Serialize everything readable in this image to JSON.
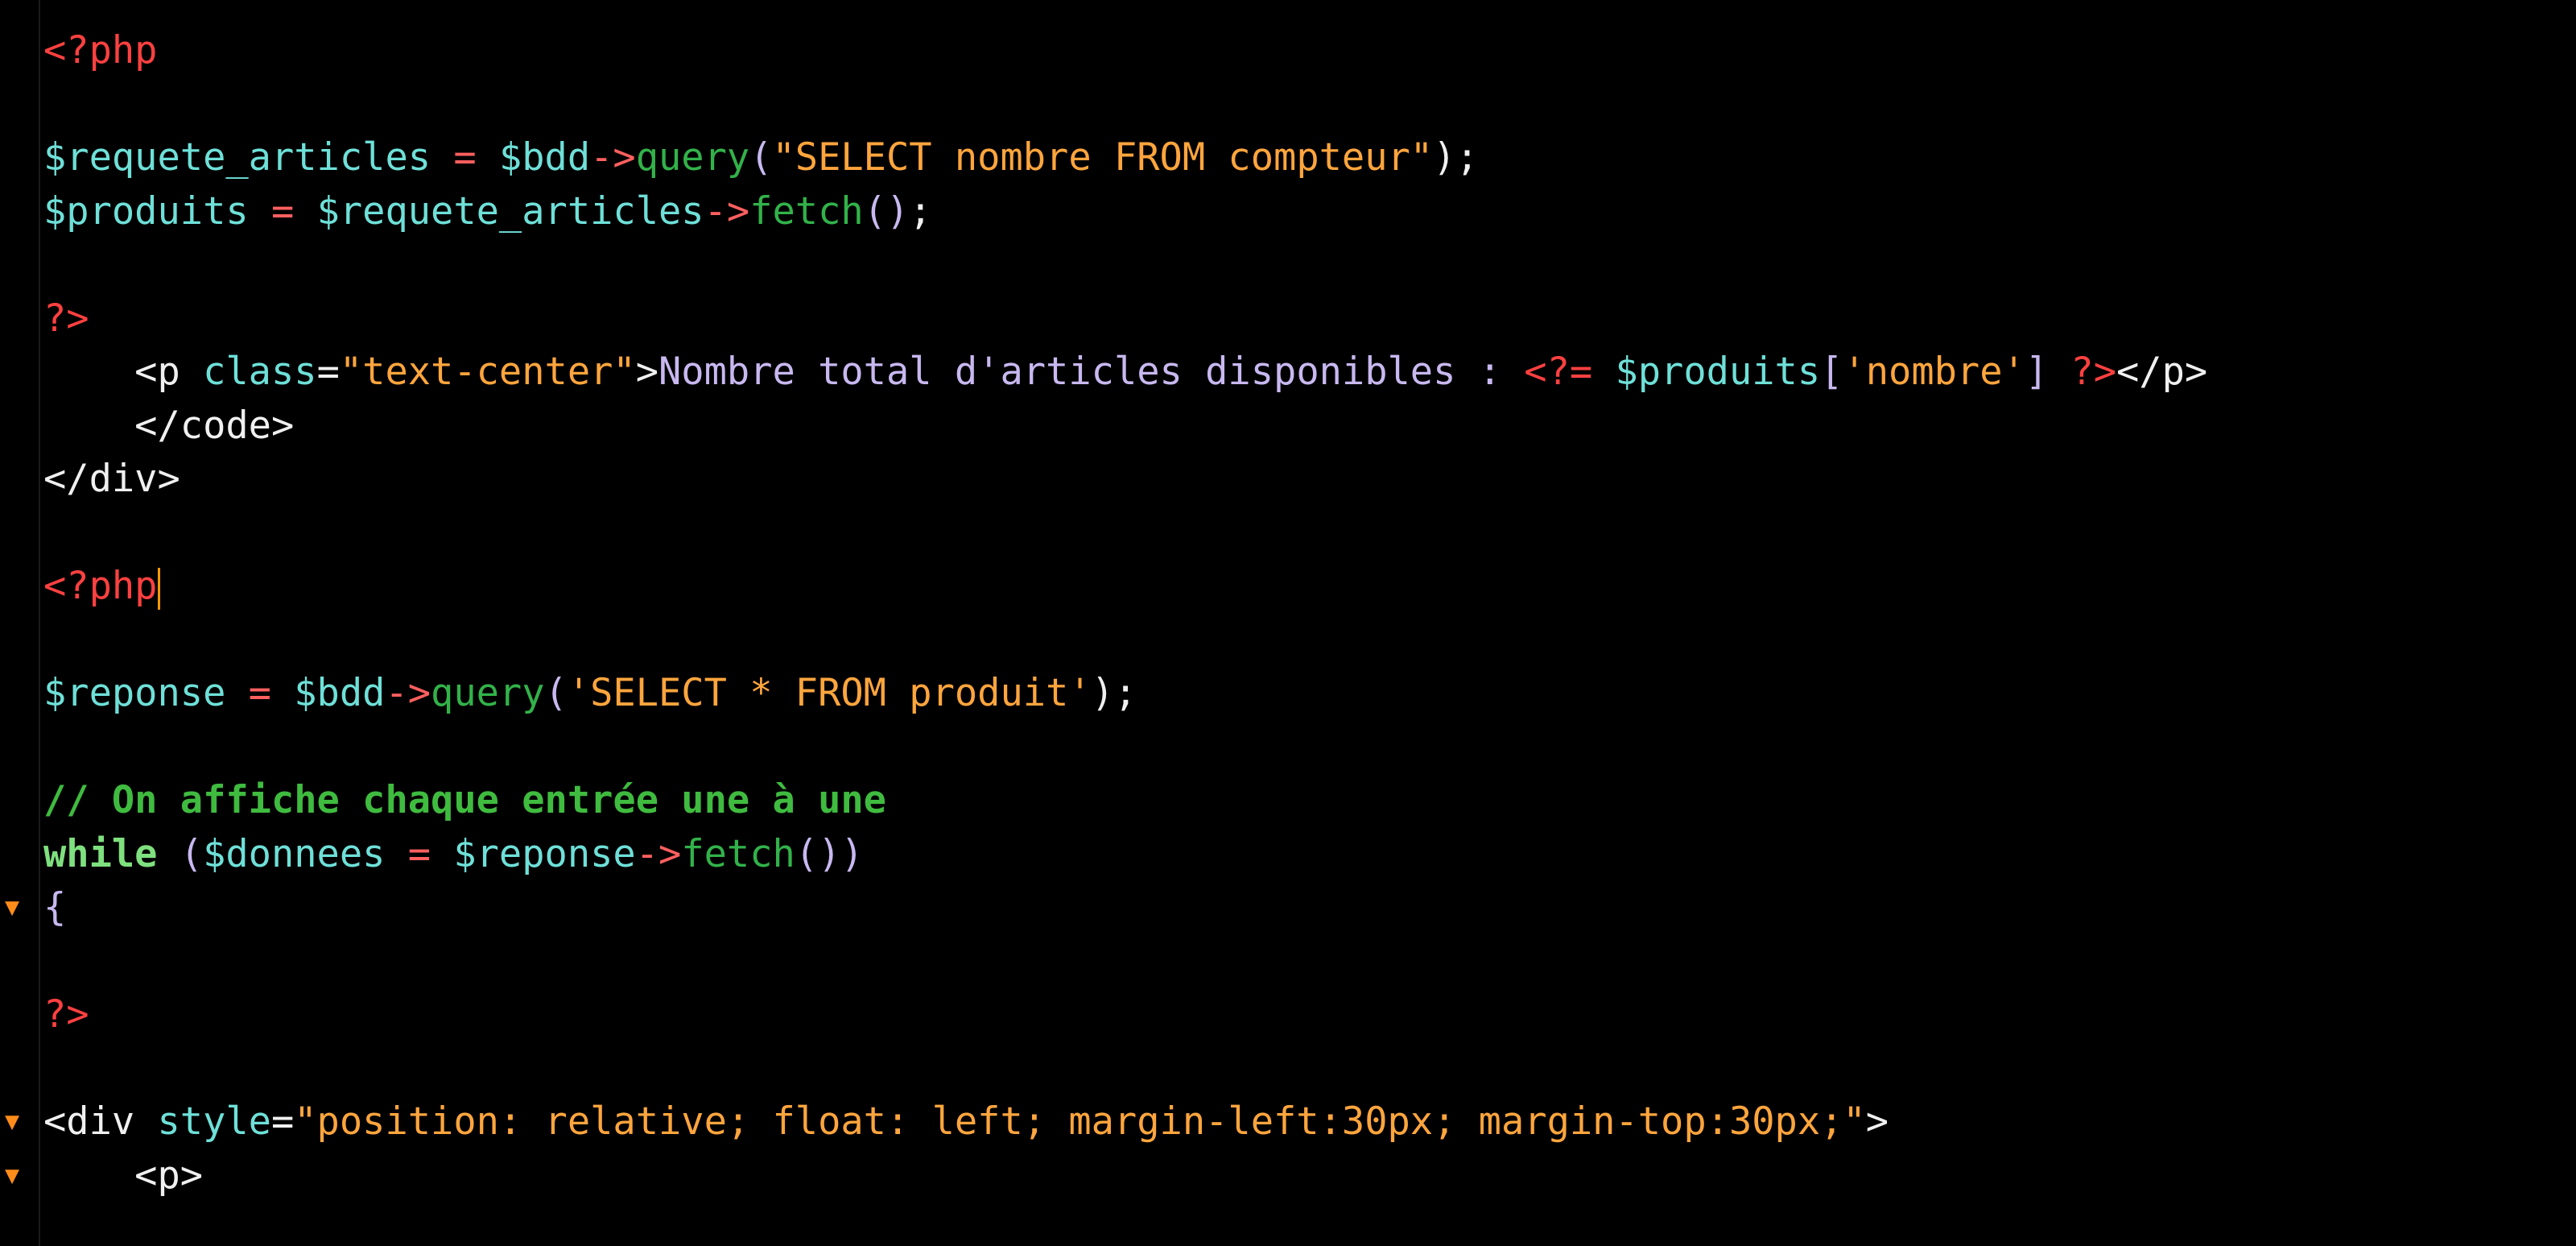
{
  "colors": {
    "background": "#000000",
    "php_tag": "#ff4040",
    "variable": "#6ee0d8",
    "operator": "#ff5f5f",
    "function": "#32b24a",
    "string": "#ffa53d",
    "html_tag": "#f0f0f0",
    "attribute": "#6ee0d8",
    "text": "#c8b8f0",
    "comment": "#3fbb3f",
    "keyword": "#7ee07e",
    "fold_marker": "#ff8c1a",
    "cursor": "#ff9900"
  },
  "fold_icon": "triangle-down",
  "lines": [
    {
      "fold": "",
      "tokens": [
        {
          "t": "<?php",
          "c": "#ff4040"
        }
      ]
    },
    {
      "fold": "",
      "tokens": []
    },
    {
      "fold": "",
      "tokens": [
        {
          "t": "$requete_articles",
          "c": "#6ee0d8"
        },
        {
          "t": " = ",
          "c": "#ff5f5f"
        },
        {
          "t": "$bdd",
          "c": "#6ee0d8"
        },
        {
          "t": "->",
          "c": "#ff5f5f"
        },
        {
          "t": "query",
          "c": "#32b24a"
        },
        {
          "t": "(",
          "c": "#c8b8f0"
        },
        {
          "t": "\"SELECT nombre FROM compteur\"",
          "c": "#ffa53d"
        },
        {
          "t": ");",
          "c": "#f0f0f0"
        }
      ]
    },
    {
      "fold": "",
      "tokens": [
        {
          "t": "$produits",
          "c": "#6ee0d8"
        },
        {
          "t": " = ",
          "c": "#ff5f5f"
        },
        {
          "t": "$requete_articles",
          "c": "#6ee0d8"
        },
        {
          "t": "->",
          "c": "#ff5f5f"
        },
        {
          "t": "fetch",
          "c": "#32b24a"
        },
        {
          "t": "()",
          "c": "#c8b8f0"
        },
        {
          "t": ";",
          "c": "#f0f0f0"
        }
      ]
    },
    {
      "fold": "",
      "tokens": []
    },
    {
      "fold": "",
      "tokens": [
        {
          "t": "?>",
          "c": "#ff4040"
        }
      ]
    },
    {
      "fold": "",
      "tokens": [
        {
          "t": "    <p ",
          "c": "#f0f0f0"
        },
        {
          "t": "class",
          "c": "#6ee0d8"
        },
        {
          "t": "=",
          "c": "#f0f0f0"
        },
        {
          "t": "\"text-center\"",
          "c": "#ffa53d"
        },
        {
          "t": ">",
          "c": "#f0f0f0"
        },
        {
          "t": "Nombre total d'articles disponibles : ",
          "c": "#c8b8f0"
        },
        {
          "t": "<?=",
          "c": "#ff4040"
        },
        {
          "t": " ",
          "c": "#f0f0f0"
        },
        {
          "t": "$produits",
          "c": "#6ee0d8"
        },
        {
          "t": "[",
          "c": "#c8b8f0"
        },
        {
          "t": "'nombre'",
          "c": "#ffa53d"
        },
        {
          "t": "] ",
          "c": "#c8b8f0"
        },
        {
          "t": "?>",
          "c": "#ff4040"
        },
        {
          "t": "</p>",
          "c": "#f0f0f0"
        }
      ]
    },
    {
      "fold": "",
      "tokens": [
        {
          "t": "    </code>",
          "c": "#f0f0f0"
        }
      ]
    },
    {
      "fold": "",
      "tokens": [
        {
          "t": "</div>",
          "c": "#f0f0f0"
        }
      ]
    },
    {
      "fold": "",
      "tokens": []
    },
    {
      "fold": "",
      "cursor": true,
      "tokens": [
        {
          "t": "<?php",
          "c": "#ff4040"
        }
      ]
    },
    {
      "fold": "",
      "tokens": []
    },
    {
      "fold": "",
      "tokens": [
        {
          "t": "$reponse",
          "c": "#6ee0d8"
        },
        {
          "t": " = ",
          "c": "#ff5f5f"
        },
        {
          "t": "$bdd",
          "c": "#6ee0d8"
        },
        {
          "t": "->",
          "c": "#ff5f5f"
        },
        {
          "t": "query",
          "c": "#32b24a"
        },
        {
          "t": "(",
          "c": "#c8b8f0"
        },
        {
          "t": "'SELECT * FROM produit'",
          "c": "#ffa53d"
        },
        {
          "t": ");",
          "c": "#f0f0f0"
        }
      ]
    },
    {
      "fold": "",
      "tokens": []
    },
    {
      "fold": "",
      "tokens": [
        {
          "t": "// On affiche chaque entrée une à une",
          "c": "#3fbb3f",
          "b": true
        }
      ]
    },
    {
      "fold": "",
      "tokens": [
        {
          "t": "while",
          "c": "#7ee07e",
          "b": true
        },
        {
          "t": " (",
          "c": "#c8b8f0"
        },
        {
          "t": "$donnees",
          "c": "#6ee0d8"
        },
        {
          "t": " = ",
          "c": "#ff5f5f"
        },
        {
          "t": "$reponse",
          "c": "#6ee0d8"
        },
        {
          "t": "->",
          "c": "#ff5f5f"
        },
        {
          "t": "fetch",
          "c": "#32b24a"
        },
        {
          "t": "())",
          "c": "#c8b8f0"
        }
      ]
    },
    {
      "fold": "▼",
      "tokens": [
        {
          "t": "{",
          "c": "#c8b8f0"
        }
      ]
    },
    {
      "fold": "",
      "tokens": []
    },
    {
      "fold": "",
      "tokens": [
        {
          "t": "?>",
          "c": "#ff4040"
        }
      ]
    },
    {
      "fold": "",
      "tokens": []
    },
    {
      "fold": "▼",
      "tokens": [
        {
          "t": "<div ",
          "c": "#f0f0f0"
        },
        {
          "t": "style",
          "c": "#6ee0d8"
        },
        {
          "t": "=",
          "c": "#f0f0f0"
        },
        {
          "t": "\"position: relative; float: left; margin-left:30px; margin-top:30px;\"",
          "c": "#ffa53d"
        },
        {
          "t": ">",
          "c": "#f0f0f0"
        }
      ]
    },
    {
      "fold": "▼",
      "tokens": [
        {
          "t": "    <p>",
          "c": "#f0f0f0"
        }
      ]
    }
  ]
}
